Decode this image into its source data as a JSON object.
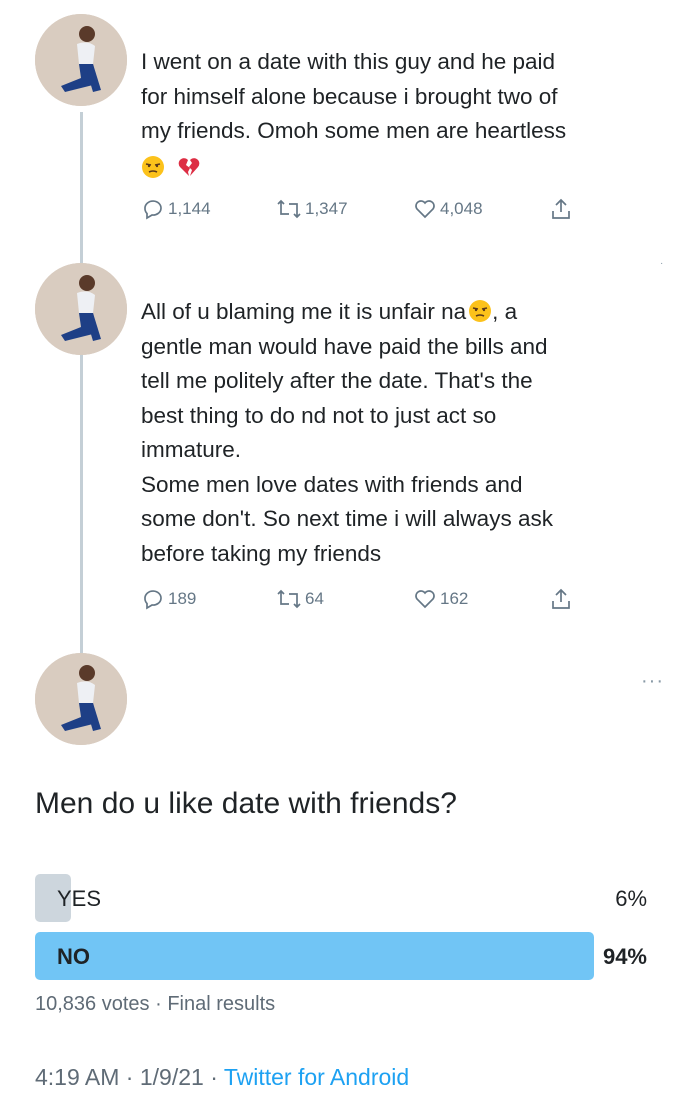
{
  "tweets": [
    {
      "lines": [
        "I went on a date with this guy and he paid",
        "for himself alone because i brought two of",
        "my friends. Omoh some men are heartless"
      ],
      "emojis": [
        "unamused-face",
        "broken-heart"
      ],
      "replies": "1,144",
      "retweets": "1,347",
      "likes": "4,048"
    },
    {
      "first_line_before_emoji": "All of u blaming me it is unfair na",
      "first_line_after_emoji": ", a",
      "lines": [
        "gentle man would have paid the bills and",
        "tell me politely after the date. That's the",
        "best thing to do nd not to just act so",
        "immature.",
        "Some men love dates with friends and",
        "some don't. So next time i will always ask",
        "before taking my friends"
      ],
      "replies": "189",
      "retweets": "64",
      "likes": "162"
    }
  ],
  "poll": {
    "question": "Men do u like date with friends?",
    "options": [
      {
        "label": "YES",
        "percent_text": "6%",
        "percent": 6
      },
      {
        "label": "NO",
        "percent_text": "94%",
        "percent": 94
      }
    ],
    "votes": "10,836 votes",
    "status": "Final results"
  },
  "footer": {
    "time": "4:19 AM",
    "date": "1/9/21",
    "source": "Twitter for Android"
  },
  "colors": {
    "winner_bar": "#71c5f5",
    "loser_bar": "#cdd6dd",
    "link": "#1da1f2"
  }
}
